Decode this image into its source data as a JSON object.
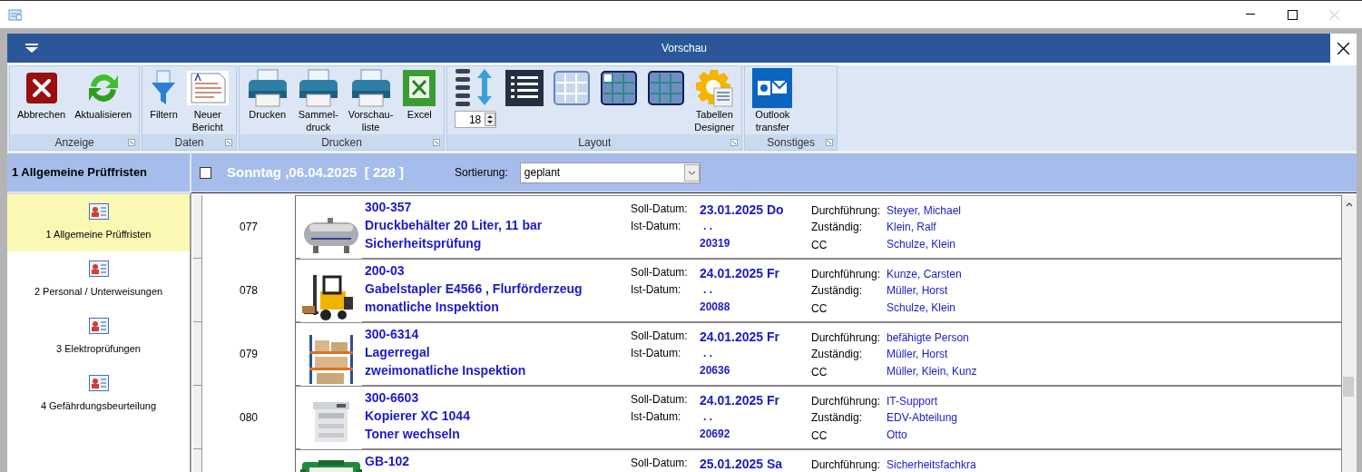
{
  "window": {
    "title": "Vorschau"
  },
  "ribbon": {
    "groups": [
      {
        "label": "Anzeige",
        "buttons": [
          {
            "kind": "cancel",
            "label": "Abbrechen"
          },
          {
            "kind": "refresh",
            "label": "Aktualisieren"
          }
        ]
      },
      {
        "label": "Daten",
        "buttons": [
          {
            "kind": "filter",
            "label": "Filtern"
          },
          {
            "kind": "report",
            "label": "Neuer\nBericht"
          }
        ]
      },
      {
        "label": "Drucken",
        "buttons": [
          {
            "kind": "print",
            "label": "Drucken"
          },
          {
            "kind": "print",
            "label": "Sammel-\ndruck"
          },
          {
            "kind": "print",
            "label": "Vorschau-\nliste"
          },
          {
            "kind": "excel",
            "label": "Excel"
          }
        ]
      },
      {
        "label": "Layout",
        "buttons": [
          {
            "kind": "rowheight",
            "value": "18"
          },
          {
            "kind": "list"
          },
          {
            "kind": "gridlight"
          },
          {
            "kind": "griddark"
          },
          {
            "kind": "gridblue"
          },
          {
            "kind": "designer",
            "label": "Tabellen\nDesigner"
          }
        ]
      },
      {
        "label": "Sonstiges",
        "buttons": [
          {
            "kind": "outlook",
            "label": "Outlook\ntransfer"
          }
        ]
      }
    ]
  },
  "sidebar": {
    "title": "1 Allgemeine Prüffristen",
    "items": [
      {
        "label": "1 Allgemeine Prüffristen",
        "selected": true
      },
      {
        "label": "2 Personal / Unterweisungen",
        "selected": false
      },
      {
        "label": "3 Elektroprüfungen",
        "selected": false
      },
      {
        "label": "4 Gefährdungsbeurteilung",
        "selected": false
      }
    ]
  },
  "header": {
    "checked": false,
    "date": "Sonntag ,06.04.2025  [ 228 ]",
    "sort_label": "Sortierung:",
    "sort_value": "geplant"
  },
  "rows": [
    {
      "number": "077",
      "code": "300-357",
      "title": "Druckbehälter 20 Liter, 11 bar",
      "task": "Sicherheitsprüfung",
      "soll_label": "Soll-Datum:",
      "soll": "23.01.2025 Do",
      "ist_label": "Ist-Datum:",
      "ist": ". .",
      "id": "20319",
      "durch_label": "Durchführung:",
      "durch": "Steyer, Michael",
      "zust_label": "Zuständig:",
      "zust": "Klein, Ralf",
      "cc_label": "CC",
      "cc": "Schulze, Klein"
    },
    {
      "number": "078",
      "code": "200-03",
      "title": "Gabelstapler E4566 , Flurförderzeug",
      "task": "monatliche Inspektion",
      "soll_label": "Soll-Datum:",
      "soll": "24.01.2025 Fr",
      "ist_label": "Ist-Datum:",
      "ist": ". .",
      "id": "20088",
      "durch_label": "Durchführung:",
      "durch": "Kunze, Carsten",
      "zust_label": "Zuständig:",
      "zust": "Müller, Horst",
      "cc_label": "CC",
      "cc": "Schulze, Klein"
    },
    {
      "number": "079",
      "code": "300-6314",
      "title": "Lagerregal",
      "task": "zweimonatliche Inspektion",
      "soll_label": "Soll-Datum:",
      "soll": "24.01.2025 Fr",
      "ist_label": "Ist-Datum:",
      "ist": ". .",
      "id": "20636",
      "durch_label": "Durchführung:",
      "durch": "befähigte Person",
      "zust_label": "Zuständig:",
      "zust": "Müller, Horst",
      "cc_label": "CC",
      "cc": "Müller, Klein, Kunz"
    },
    {
      "number": "080",
      "code": "300-6603",
      "title": "Kopierer  XC 1044",
      "task": "Toner wechseln",
      "soll_label": "Soll-Datum:",
      "soll": "24.01.2025 Fr",
      "ist_label": "Ist-Datum:",
      "ist": ". .",
      "id": "20692",
      "durch_label": "Durchführung:",
      "durch": "IT-Support",
      "zust_label": "Zuständig:",
      "zust": "EDV-Abteilung",
      "cc_label": "CC",
      "cc": "Otto"
    },
    {
      "code": "GB-102",
      "soll_label": "Soll-Datum:",
      "soll": "25.01.2025 Sa",
      "durch_label": "Durchführung:",
      "durch": "Sicherheitsfachkra"
    }
  ]
}
